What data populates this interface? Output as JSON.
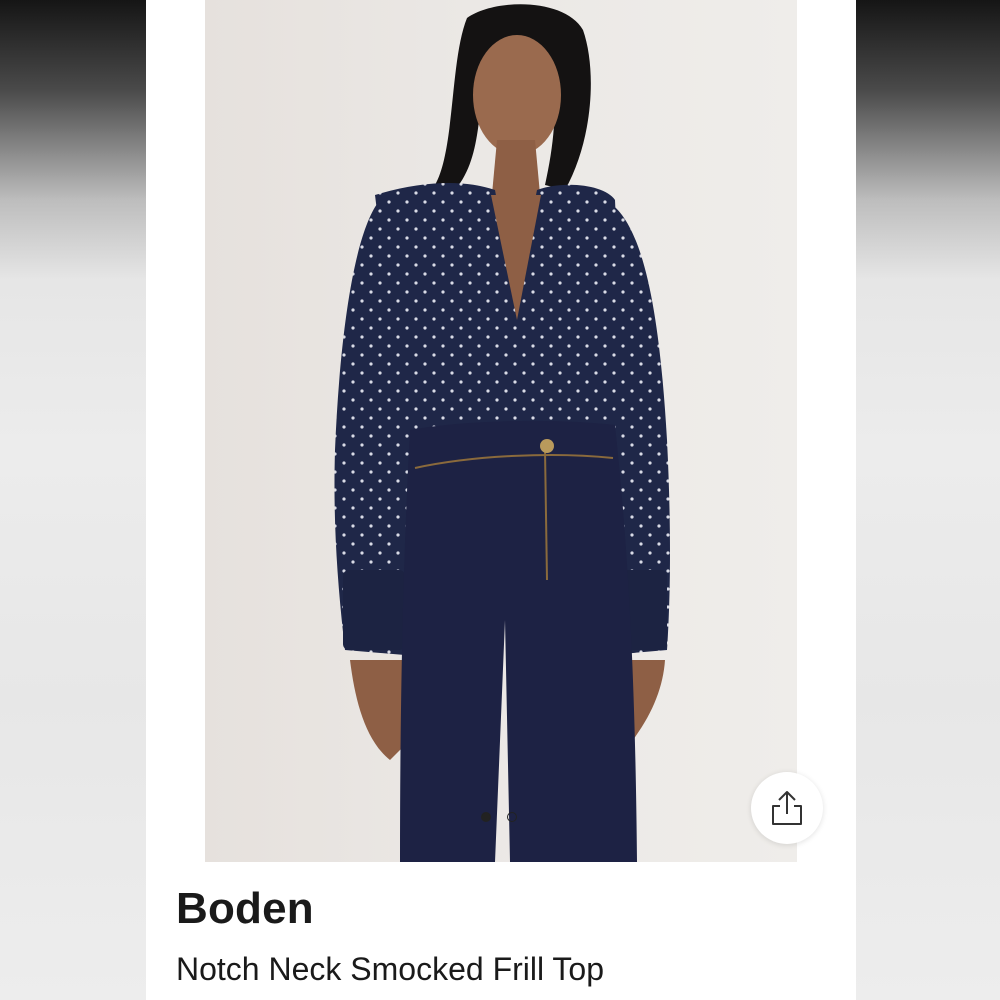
{
  "listing": {
    "brand": "Boden",
    "title": "Notch Neck Smocked Frill Top"
  },
  "carousel": {
    "image_count": 2,
    "active_index": 0
  },
  "actions": {
    "share_icon": "share-icon"
  },
  "colors": {
    "top": "#1f2748",
    "jeans": "#1d2244",
    "backdrop": "#ebe8e5"
  }
}
